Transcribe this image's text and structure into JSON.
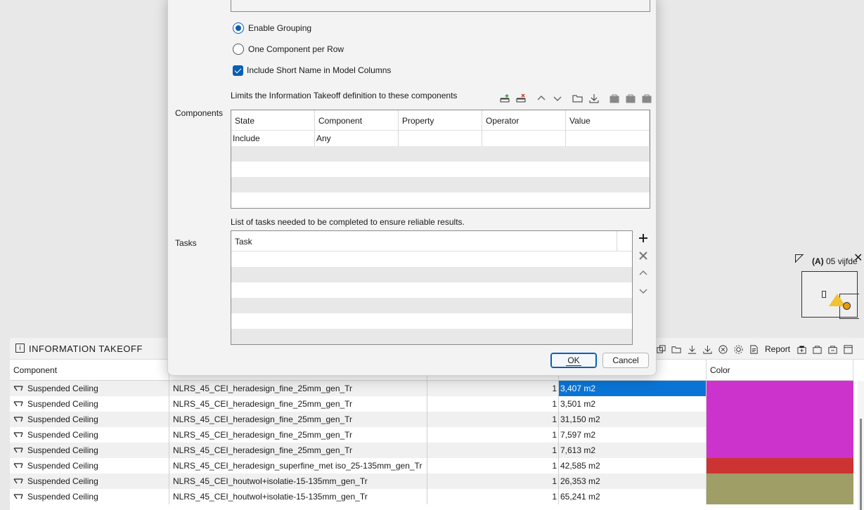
{
  "dialog": {
    "grouping_options": {
      "enable_grouping": "Enable Grouping",
      "one_per_row": "One Component per Row",
      "short_name": "Include Short Name in Model Columns"
    },
    "components": {
      "label": "Components",
      "description": "Limits the Information Takeoff definition to these components",
      "columns": [
        "State",
        "Component",
        "Property",
        "Operator",
        "Value"
      ],
      "rows": [
        {
          "state": "Include",
          "component": "Any",
          "property": "",
          "operator": "",
          "value": ""
        }
      ],
      "toolbar_icons": [
        "add-row-icon",
        "remove-row-icon",
        "move-up-icon",
        "move-down-icon",
        "open-folder-icon",
        "import-icon",
        "bag-icon",
        "bag-icon",
        "bag-icon"
      ]
    },
    "tasks": {
      "label": "Tasks",
      "description": "List of tasks needed to be completed to ensure reliable results.",
      "column": "Task",
      "toolbar_icons": [
        "plus-icon",
        "close-icon",
        "chevron-up-icon",
        "chevron-down-icon"
      ]
    },
    "ok_label": "OK",
    "cancel_label": "Cancel"
  },
  "navigator": {
    "title_bold": "(A)",
    "title_rest": " 05 vijfde"
  },
  "palette": {
    "title": "INFORMATION TAKEOFF",
    "report_label": "Report",
    "columns": {
      "component": "Component",
      "color": "Color"
    },
    "rows": [
      {
        "component": "Suspended Ceiling",
        "type": "NLRS_45_CEI_heradesign_fine_25mm_gen_Tr",
        "count": "1",
        "area": "3,407 m2",
        "color": "#cc33cc",
        "selected": true
      },
      {
        "component": "Suspended Ceiling",
        "type": "NLRS_45_CEI_heradesign_fine_25mm_gen_Tr",
        "count": "1",
        "area": "3,501 m2",
        "color": "#cc33cc"
      },
      {
        "component": "Suspended Ceiling",
        "type": "NLRS_45_CEI_heradesign_fine_25mm_gen_Tr",
        "count": "1",
        "area": "31,150 m2",
        "color": "#cc33cc"
      },
      {
        "component": "Suspended Ceiling",
        "type": "NLRS_45_CEI_heradesign_fine_25mm_gen_Tr",
        "count": "1",
        "area": "7,597 m2",
        "color": "#cc33cc"
      },
      {
        "component": "Suspended Ceiling",
        "type": "NLRS_45_CEI_heradesign_fine_25mm_gen_Tr",
        "count": "1",
        "area": "7,613 m2",
        "color": "#cc33cc"
      },
      {
        "component": "Suspended Ceiling",
        "type": "NLRS_45_CEI_heradesign_superfine_met iso_25-135mm_gen_Tr",
        "count": "1",
        "area": "42,585 m2",
        "color": "#cc3333"
      },
      {
        "component": "Suspended Ceiling",
        "type": "NLRS_45_CEI_houtwol+isolatie-15-135mm_gen_Tr",
        "count": "1",
        "area": "26,353 m2",
        "color": "#9e9e66"
      },
      {
        "component": "Suspended Ceiling",
        "type": "NLRS_45_CEI_houtwol+isolatie-15-135mm_gen_Tr",
        "count": "1",
        "area": "65,241 m2",
        "color": "#9e9e66"
      }
    ]
  }
}
